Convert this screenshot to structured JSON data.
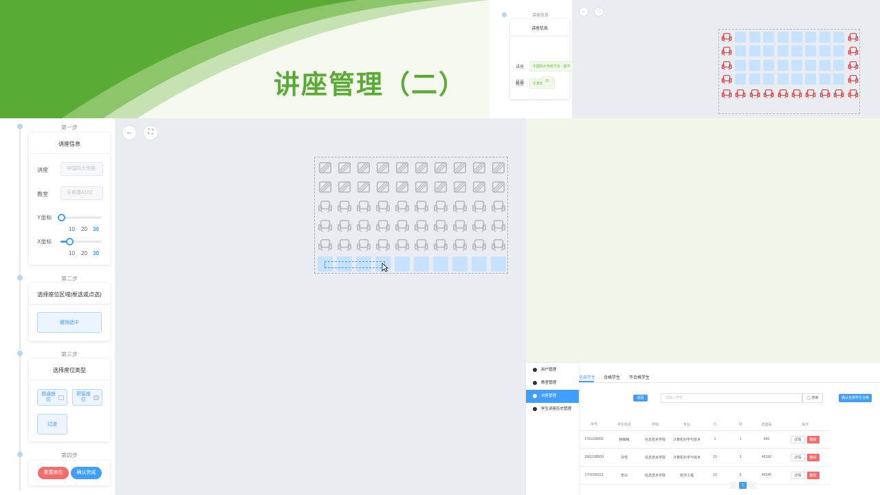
{
  "banner": {
    "title": "讲座管理（二）"
  },
  "mini_preview": {
    "step_label": "讲座信息",
    "card_title": "讲座信息",
    "rows": [
      {
        "label": "讲座",
        "value": "中国四大传统节日 - 春节"
      },
      {
        "label": "教室",
        "value": "乐育楼A102"
      },
      {
        "label": "已选",
        "value": "19"
      }
    ],
    "back_icon": "←",
    "fullscreen_icon": "⛶"
  },
  "steps": {
    "step1": {
      "label": "第一步",
      "title": "讲座信息",
      "lecture_label": "讲座",
      "lecture_value": "中国四大传统",
      "room_label": "教室",
      "room_value": "乐育楼A102",
      "y_label": "Y坐标",
      "x_label": "X坐标",
      "marks": [
        "10",
        "20",
        "30"
      ],
      "y_level": 0.0,
      "x_level": 0.2
    },
    "step2": {
      "label": "第二步",
      "title": "选择座位区域(框选或点选)",
      "button": "撤销选中"
    },
    "step3": {
      "label": "第三步",
      "title": "选择座位类型",
      "types": [
        {
          "label": "普通座位"
        },
        {
          "label": "预留座位"
        },
        {
          "label": "过道"
        }
      ]
    },
    "step4": {
      "label": "第四步",
      "reset": "重置座位",
      "confirm": "确认完成"
    }
  },
  "editor": {
    "back_icon": "←",
    "fullscreen_icon": "⛶"
  },
  "admin": {
    "nav": [
      "用户管理",
      "教室管理",
      "讲座管理",
      "学生讲座历史管理"
    ],
    "active_nav": 2,
    "tabs": [
      "全部学生",
      "合格学生",
      "不合格学生"
    ],
    "back_button": "返回",
    "search_placeholder": "请输入学号",
    "search_button": "◯ 搜索",
    "confirm_all": "确认全部学生合格",
    "columns": [
      "学号",
      "学生姓名",
      "学院",
      "专业",
      "行",
      "列",
      "选座码",
      "操作"
    ],
    "rows": [
      [
        "1701030006",
        "韩梅梅",
        "信息技术学院",
        "计算机科学与技术",
        "1",
        "1",
        "666"
      ],
      [
        "1801030009",
        "孙悟",
        "信息技术学院",
        "计算机科学与技术",
        "10",
        "3",
        "46190"
      ],
      [
        "1701030111",
        "李白",
        "信息技术学院",
        "软件工程",
        "10",
        "5",
        "46240"
      ]
    ],
    "detail": "详情",
    "delete": "删除",
    "page": "1",
    "prev": "‹",
    "next": "›"
  },
  "colors": {
    "brand_green": "#5aab35",
    "primary": "#409eff",
    "danger": "#f56c6c",
    "seat_selected": "#c6e2ff"
  }
}
